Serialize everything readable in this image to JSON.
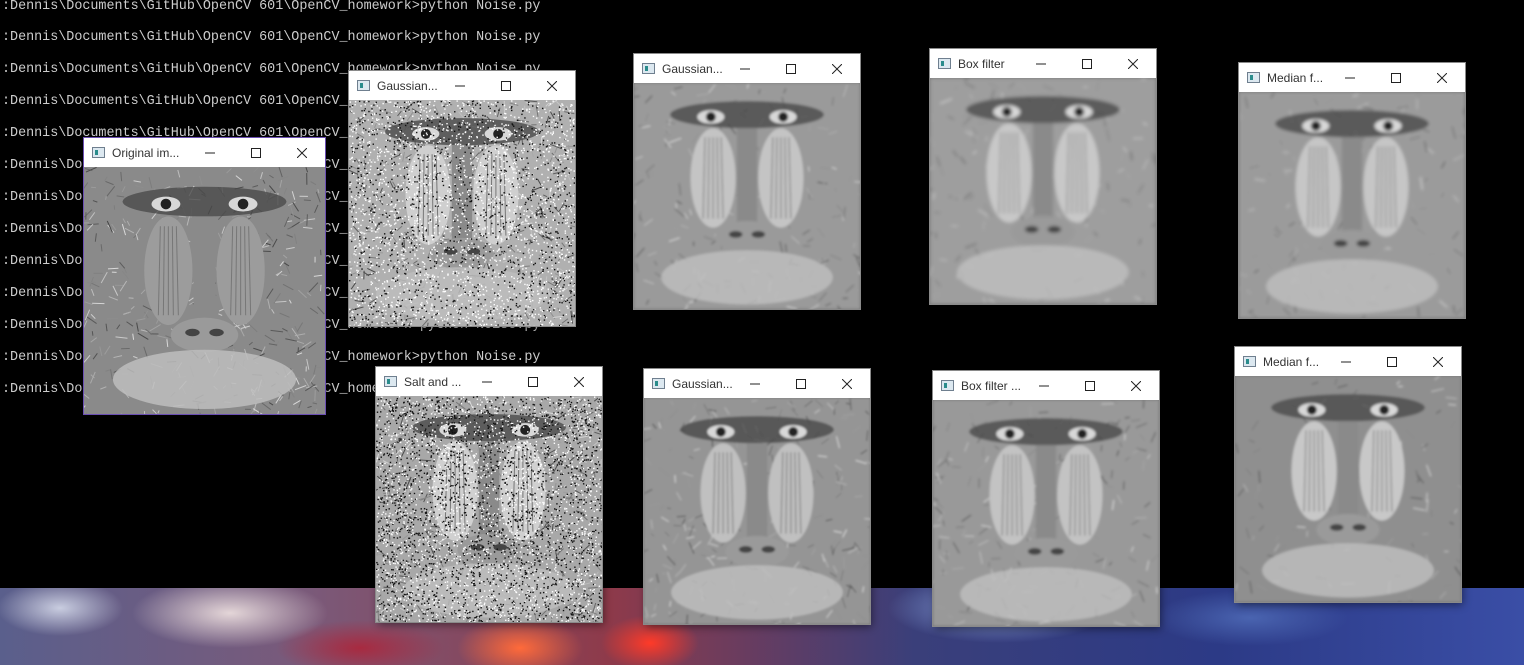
{
  "terminal": {
    "lines": [
      ":Dennis\\Documents\\GitHub\\OpenCV 601\\OpenCV_homework>python Noise.py",
      ":Dennis\\Documents\\GitHub\\OpenCV 601\\OpenCV_homework>python Noise.py",
      ":Dennis\\Documents\\GitHub\\OpenCV 601\\OpenCV_homework>python Noise.py",
      ":Dennis\\Documents\\GitHub\\OpenCV 601\\OpenCV_homework>python Noise.py",
      ":Dennis\\Documents\\GitHub\\OpenCV 601\\OpenCV_homework>python Noise.py",
      ":Dennis\\Documents\\GitHub\\OpenCV 601\\OpenCV_homework>python Noise.py",
      ":Dennis\\Documents\\GitHub\\OpenCV 601\\OpenCV_homework>python Noise.py",
      ":Dennis\\Documents\\GitHub\\OpenCV 601\\OpenCV_homework>python Noise.py",
      ":Dennis\\Documents\\GitHub\\OpenCV 601\\OpenCV_homework>python Noise.py",
      ":Dennis\\Documents\\GitHub\\OpenCV 601\\OpenCV_homework>python Noise.py",
      ":Dennis\\Documents\\GitHub\\OpenCV 601\\OpenCV_homework>python Noise.py",
      ":Dennis\\Documents\\GitHub\\OpenCV 601\\OpenCV_homework>python Noise.py",
      ":Dennis\\Documents\\GitHub\\OpenCV 601\\OpenCV_homework>python Noise.py"
    ]
  },
  "windows": [
    {
      "id": "original",
      "title": "Original im...",
      "image": "mandrill (original)"
    },
    {
      "id": "gaussian-noise",
      "title": "Gaussian...",
      "image": "mandrill (heavy noise)"
    },
    {
      "id": "gaussian-filter-1",
      "title": "Gaussian...",
      "image": "mandrill (gaussian filtered)"
    },
    {
      "id": "box-filter-1",
      "title": "Box filter",
      "image": "mandrill (box filtered)"
    },
    {
      "id": "median-filter-1",
      "title": "Median f...",
      "image": "mandrill (median filtered)"
    },
    {
      "id": "salt-pepper",
      "title": "Salt and ...",
      "image": "mandrill (salt and pepper noise)"
    },
    {
      "id": "gaussian-filter-2",
      "title": "Gaussian...",
      "image": "mandrill (gaussian filtered)"
    },
    {
      "id": "box-filter-2",
      "title": "Box filter ...",
      "image": "mandrill (box filtered)"
    },
    {
      "id": "median-filter-2",
      "title": "Median f...",
      "image": "mandrill (median filtered)"
    }
  ],
  "icons": {
    "minimize": "minimize-icon",
    "maximize": "maximize-icon",
    "close": "close-icon"
  },
  "colors": {
    "terminal_bg": "#000000",
    "terminal_text": "#cccccc",
    "active_border": "#6b4fb3"
  }
}
